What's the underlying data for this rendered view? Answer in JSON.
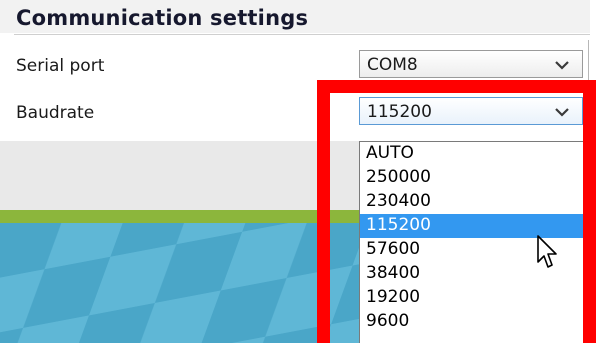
{
  "section": {
    "title": "Communication settings"
  },
  "settings": {
    "serial_port": {
      "label": "Serial port",
      "value": "COM8",
      "icon": "chevron-down-icon"
    },
    "baudrate": {
      "label": "Baudrate",
      "value": "115200",
      "icon": "chevron-down-icon"
    }
  },
  "baudrate_options": [
    "AUTO",
    "250000",
    "230400",
    "115200",
    "57600",
    "38400",
    "19200",
    "9600"
  ],
  "selected_option": "115200",
  "colors": {
    "highlight": "#ff0000",
    "selection": "#3398f0",
    "accent_bar": "#8cb63c",
    "viewport_tiles": [
      "#5fb7d6",
      "#4aa6c8"
    ]
  },
  "pointer": {
    "icon": "mouse-pointer-icon"
  }
}
